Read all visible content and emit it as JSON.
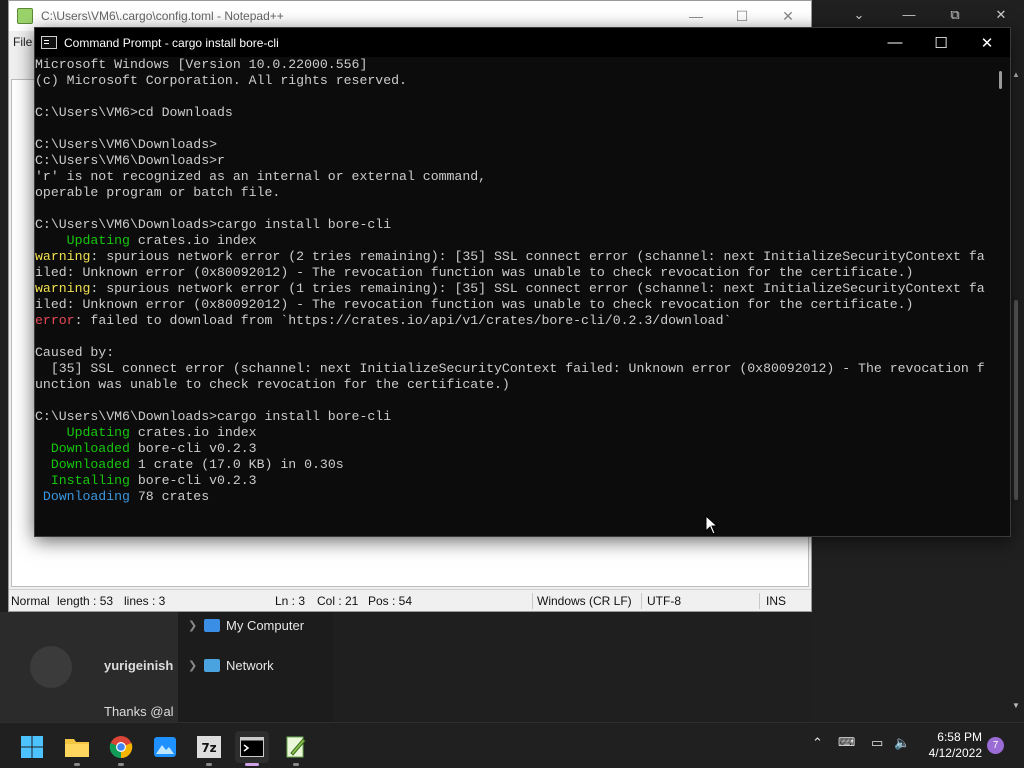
{
  "notepad": {
    "title": "C:\\Users\\VM6\\.cargo\\config.toml - Notepad++",
    "menu_file": "File",
    "status": {
      "mode": "Normal",
      "length": "length : 53",
      "lines": "lines : 3",
      "ln": "Ln : 3",
      "col": "Col : 21",
      "pos": "Pos : 54",
      "eol": "Windows (CR LF)",
      "encoding": "UTF-8",
      "ins": "INS"
    }
  },
  "cmd": {
    "title": "Command Prompt - cargo  install bore-cli",
    "lines": [
      {
        "parts": [
          {
            "t": "Microsoft Windows [Version 10.0.22000.556]",
            "c": ""
          }
        ]
      },
      {
        "parts": [
          {
            "t": "(c) Microsoft Corporation. All rights reserved.",
            "c": ""
          }
        ]
      },
      {
        "parts": [
          {
            "t": "",
            "c": ""
          }
        ]
      },
      {
        "parts": [
          {
            "t": "C:\\Users\\VM6>cd Downloads",
            "c": ""
          }
        ]
      },
      {
        "parts": [
          {
            "t": "",
            "c": ""
          }
        ]
      },
      {
        "parts": [
          {
            "t": "C:\\Users\\VM6\\Downloads>",
            "c": ""
          }
        ]
      },
      {
        "parts": [
          {
            "t": "C:\\Users\\VM6\\Downloads>r",
            "c": ""
          }
        ]
      },
      {
        "parts": [
          {
            "t": "'r' is not recognized as an internal or external command,",
            "c": ""
          }
        ]
      },
      {
        "parts": [
          {
            "t": "operable program or batch file.",
            "c": ""
          }
        ]
      },
      {
        "parts": [
          {
            "t": "",
            "c": ""
          }
        ]
      },
      {
        "parts": [
          {
            "t": "C:\\Users\\VM6\\Downloads>cargo install bore-cli",
            "c": ""
          }
        ]
      },
      {
        "parts": [
          {
            "t": "    Updating",
            "c": "c-grn"
          },
          {
            "t": " crates.io index",
            "c": ""
          }
        ]
      },
      {
        "parts": [
          {
            "t": "warning",
            "c": "c-warn"
          },
          {
            "t": ": spurious network error (2 tries remaining): [35] SSL connect error (schannel: next InitializeSecurityContext fa",
            "c": ""
          }
        ]
      },
      {
        "parts": [
          {
            "t": "iled: Unknown error (0x80092012) - The revocation function was unable to check revocation for the certificate.)",
            "c": ""
          }
        ]
      },
      {
        "parts": [
          {
            "t": "warning",
            "c": "c-warn"
          },
          {
            "t": ": spurious network error (1 tries remaining): [35] SSL connect error (schannel: next InitializeSecurityContext fa",
            "c": ""
          }
        ]
      },
      {
        "parts": [
          {
            "t": "iled: Unknown error (0x80092012) - The revocation function was unable to check revocation for the certificate.)",
            "c": ""
          }
        ]
      },
      {
        "parts": [
          {
            "t": "error",
            "c": "c-err"
          },
          {
            "t": ": failed to download from `https://crates.io/api/v1/crates/bore-cli/0.2.3/download`",
            "c": ""
          }
        ]
      },
      {
        "parts": [
          {
            "t": "",
            "c": ""
          }
        ]
      },
      {
        "parts": [
          {
            "t": "Caused by:",
            "c": ""
          }
        ]
      },
      {
        "parts": [
          {
            "t": "  [35] SSL connect error (schannel: next InitializeSecurityContext failed: Unknown error (0x80092012) - The revocation f",
            "c": ""
          }
        ]
      },
      {
        "parts": [
          {
            "t": "unction was unable to check revocation for the certificate.)",
            "c": ""
          }
        ]
      },
      {
        "parts": [
          {
            "t": "",
            "c": ""
          }
        ]
      },
      {
        "parts": [
          {
            "t": "C:\\Users\\VM6\\Downloads>cargo install bore-cli",
            "c": ""
          }
        ]
      },
      {
        "parts": [
          {
            "t": "    Updating",
            "c": "c-grn"
          },
          {
            "t": " crates.io index",
            "c": ""
          }
        ]
      },
      {
        "parts": [
          {
            "t": "  Downloaded",
            "c": "c-grn"
          },
          {
            "t": " bore-cli v0.2.3",
            "c": ""
          }
        ]
      },
      {
        "parts": [
          {
            "t": "  Downloaded",
            "c": "c-grn"
          },
          {
            "t": " 1 crate (17.0 KB) in 0.30s",
            "c": ""
          }
        ]
      },
      {
        "parts": [
          {
            "t": "  Installing",
            "c": "c-grn"
          },
          {
            "t": " bore-cli v0.2.3",
            "c": ""
          }
        ]
      },
      {
        "parts": [
          {
            "t": " Downloading",
            "c": "c-cyan"
          },
          {
            "t": " 78 crates",
            "c": ""
          }
        ]
      }
    ]
  },
  "background": {
    "chat_user": "yurigeinish",
    "chat_message": "Thanks @al",
    "explorer_items": [
      "My Computer",
      "Network"
    ]
  },
  "taskbar": {
    "apps": [
      "start",
      "file-explorer",
      "chrome",
      "photos",
      "7-zip",
      "command-prompt",
      "notepad-plus-plus"
    ],
    "time": "6:58 PM",
    "date": "4/12/2022",
    "notification_count": "7"
  },
  "colors": {
    "console_bg": "#0c0c0c",
    "warning": "#f0e050",
    "error": "#e74856",
    "cargo_green": "#16c60c",
    "cargo_cyan": "#3a96dd"
  }
}
